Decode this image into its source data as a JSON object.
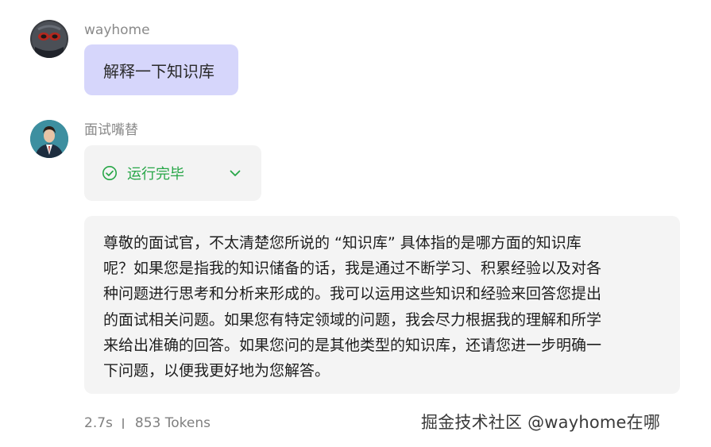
{
  "user_message": {
    "username": "wayhome",
    "text": "解释一下知识库"
  },
  "bot_message": {
    "username": "面试嘴替",
    "status": {
      "label": "运行完毕",
      "icon": "check-circle-icon",
      "color": "#27a647"
    },
    "answer_lines": [
      "尊敬的面试官，不太清楚您所说的 “知识库” 具体指的是哪方面的知识库",
      "呢？如果您是指我的知识储备的话，我是通过不断学习、积累经验以及对各",
      "种问题进行思考和分析来形成的。我可以运用这些知识和经验来回答您提出",
      "的面试相关问题。如果您有特定领域的问题，我会尽力根据我的理解和所学",
      "来给出准确的回答。如果您问的是其他类型的知识库，还请您进一步明确一",
      "下问题，以便我更好地为您解答。"
    ],
    "meta": {
      "duration": "2.7s",
      "tokens": "853 Tokens"
    }
  },
  "watermark": "掘金技术社区 @wayhome在哪",
  "colors": {
    "user_bubble": "#d6d6fb",
    "card_bg": "#f4f4f4",
    "status_green": "#27a647"
  }
}
